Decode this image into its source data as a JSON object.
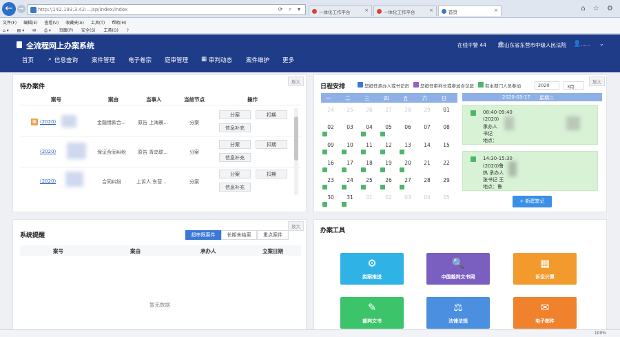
{
  "browser": {
    "address": "http://142.193.3.42:...jsp/index/index",
    "tabs": [
      {
        "label": "一体化工作平台"
      },
      {
        "label": "一体化工作平台"
      },
      {
        "label": "首页"
      }
    ],
    "menu": [
      "文件(F)",
      "编辑(E)",
      "查看(V)",
      "收藏夹(A)",
      "工具(T)",
      "帮助(H)"
    ],
    "commands": [
      "页面(P)",
      "安全(S)",
      "工具(O)"
    ],
    "zoom": "100%"
  },
  "header": {
    "title": "全流程网上办案系统",
    "online": "在线干警 44",
    "court": "山东省东营市中级人民法院",
    "user": "......",
    "nav": [
      "首页",
      "信息查询",
      "案件管理",
      "电子卷宗",
      "庭审管理",
      "审判动态",
      "案件维护",
      "更多"
    ]
  },
  "pending": {
    "title": "待办案件",
    "expand": "放大",
    "columns": [
      "案号",
      "案由",
      "当事人",
      "当前节点",
      "操作"
    ],
    "rows": [
      {
        "case_no": "(2020)",
        "cause": "金融借款合...",
        "party": "原告 上海晨...",
        "node": "分案",
        "actions": [
          "分案",
          "扣期",
          "信息补充"
        ]
      },
      {
        "case_no": "(2020)",
        "cause": "保证合同纠纷",
        "party": "原告 青岛联...",
        "node": "分案",
        "actions": [
          "分案",
          "扣期",
          "信息补充"
        ]
      },
      {
        "case_no": "(2020)",
        "cause": "合同纠纷",
        "party": "上诉人 东营...",
        "node": "分案",
        "actions": [
          "分案",
          "扣期",
          "信息补充"
        ]
      }
    ]
  },
  "schedule": {
    "title": "日程安排",
    "expand": "放大",
    "legend": [
      {
        "label": "您担任承办人或书记员",
        "color": "#3b78d8"
      },
      {
        "label": "您担任审判长或参加合议庭",
        "color": "#9b5fc0"
      },
      {
        "label": "有本部门人员参加",
        "color": "#4fb56a"
      }
    ],
    "year": "2020",
    "month": "3月",
    "weekdays": [
      "一",
      "二",
      "三",
      "四",
      "五",
      "六",
      "日"
    ],
    "weeks": [
      [
        {
          "d": "24",
          "m": true
        },
        {
          "d": "25",
          "m": true
        },
        {
          "d": "26",
          "m": true
        },
        {
          "d": "27",
          "m": true
        },
        {
          "d": "28",
          "m": true
        },
        {
          "d": "29",
          "m": true
        },
        {
          "d": "01"
        }
      ],
      [
        {
          "d": "02",
          "e": true
        },
        {
          "d": "03"
        },
        {
          "d": "04",
          "e": true
        },
        {
          "d": "05",
          "e": true
        },
        {
          "d": "06"
        },
        {
          "d": "07"
        },
        {
          "d": "08"
        }
      ],
      [
        {
          "d": "09",
          "e": true
        },
        {
          "d": "10",
          "e": true
        },
        {
          "d": "11",
          "e": true
        },
        {
          "d": "12",
          "e": true
        },
        {
          "d": "13",
          "e": true
        },
        {
          "d": "14"
        },
        {
          "d": "15"
        }
      ],
      [
        {
          "d": "16",
          "e": true
        },
        {
          "d": "17",
          "e": true
        },
        {
          "d": "18",
          "e": true
        },
        {
          "d": "19",
          "e": true
        },
        {
          "d": "20",
          "e": true
        },
        {
          "d": "21"
        },
        {
          "d": "22"
        }
      ],
      [
        {
          "d": "23",
          "e": true
        },
        {
          "d": "24",
          "e": true
        },
        {
          "d": "25",
          "e": true
        },
        {
          "d": "26",
          "e": true
        },
        {
          "d": "27",
          "e": true
        },
        {
          "d": "28"
        },
        {
          "d": "29"
        }
      ],
      [
        {
          "d": "30",
          "e": true
        },
        {
          "d": "31",
          "e": true
        },
        {
          "d": "01",
          "m": true
        },
        {
          "d": "02",
          "m": true
        },
        {
          "d": "03",
          "m": true
        },
        {
          "d": "04",
          "m": true
        },
        {
          "d": "05",
          "m": true
        }
      ]
    ],
    "selected_date": "2020-03-17",
    "selected_weekday": "星期二",
    "events": [
      {
        "lines": [
          "08:40-09:40",
          "(2020)",
          "承办人",
          "书记",
          "地点："
        ]
      },
      {
        "lines": [
          "14:30-15:30",
          "(2020)鲁",
          "热 承办人",
          "张书记 王",
          "地点：鲁"
        ]
      }
    ],
    "new_button": "+ 新建笔记"
  },
  "reminder": {
    "title": "系统提醒",
    "expand": "放大",
    "tabs": [
      "超审限案件",
      "长期未结案",
      "重点案件"
    ],
    "columns": [
      "案号",
      "案由",
      "承办人",
      "立案日期"
    ],
    "empty": "暂无数据"
  },
  "tools": {
    "title": "办案工具",
    "items": [
      {
        "label": "类案推送",
        "icon": "brain-icon",
        "color": "#2fb3e6",
        "glyph": "⚙"
      },
      {
        "label": "中国裁判文书网",
        "icon": "document-search-icon",
        "color": "#7a5fc0",
        "glyph": "🔍"
      },
      {
        "label": "诉讼计算",
        "icon": "calculator-icon",
        "color": "#f29a2e",
        "glyph": "▦"
      },
      {
        "label": "裁判文书",
        "icon": "document-edit-icon",
        "color": "#3cc46a",
        "glyph": "✎"
      },
      {
        "label": "法律法规",
        "icon": "gavel-icon",
        "color": "#4a8fe0",
        "glyph": "⚖"
      },
      {
        "label": "电子邮件",
        "icon": "mail-icon",
        "color": "#f0812d",
        "glyph": "✉"
      }
    ]
  }
}
